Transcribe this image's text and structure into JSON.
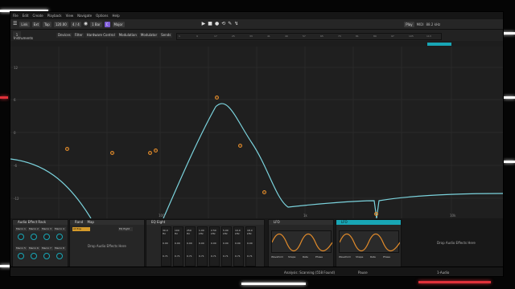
{
  "menu": [
    "File",
    "Edit",
    "Create",
    "Playback",
    "View",
    "Navigate",
    "Options",
    "Help"
  ],
  "transport": {
    "labels": [
      "Link",
      "Ext",
      "Tap",
      "120.00",
      "4 / 4",
      "1 Bar",
      "C",
      "Major"
    ],
    "right": [
      "Play",
      "MIDI",
      "88.2 kHz"
    ]
  },
  "track": {
    "label": "1"
  },
  "instrument_label": "Instruments",
  "device_tabs": [
    "Devices",
    "Filter",
    "Hardware Control",
    "Modulation",
    "Modulator",
    "Sends"
  ],
  "ruler_ticks": [
    "1",
    "9",
    "17",
    "25",
    "33",
    "41",
    "49",
    "57",
    "65",
    "73",
    "81",
    "89",
    "97",
    "105",
    "113"
  ],
  "db_labels": [
    "12",
    "6",
    "0",
    "-6",
    "-12"
  ],
  "freq_labels": [
    "100",
    "1k",
    "10k"
  ],
  "bottom": {
    "rack_title": "Audio Effect Rack",
    "rack_buttons": [
      "Rand",
      "Map"
    ],
    "macros": [
      "Macro 1",
      "Macro 2",
      "Macro 3",
      "Macro 4",
      "Macro 5",
      "Macro 6",
      "Macro 7",
      "Macro 8"
    ],
    "rack_list_title": "All Eqs",
    "chain_label": "EQ Eight",
    "drop_chain": "Drop Audio Effects Here",
    "eq_title": "EQ Eight",
    "eq_cols": [
      {
        "freq": "30.0 Hz",
        "gain": "0.00",
        "q": "0.71"
      },
      {
        "freq": "100 Hz",
        "gain": "0.00",
        "q": "0.71"
      },
      {
        "freq": "250 Hz",
        "gain": "0.00",
        "q": "0.71"
      },
      {
        "freq": "1.00 kHz",
        "gain": "0.00",
        "q": "0.71"
      },
      {
        "freq": "2.50 kHz",
        "gain": "0.00",
        "q": "0.71"
      },
      {
        "freq": "5.00 kHz",
        "gain": "0.00",
        "q": "0.71"
      },
      {
        "freq": "10.0 kHz",
        "gain": "0.00",
        "q": "0.71"
      },
      {
        "freq": "18.0 kHz",
        "gain": "0.00",
        "q": "0.71"
      }
    ],
    "lfo1_title": "LFO",
    "lfo2_title": "LFO",
    "lfo_params": [
      "Waveform",
      "Shape",
      "Rate",
      "Phase"
    ],
    "drop_main": "Drop Audio Effects Here"
  },
  "status": {
    "center": "Analysis: Scanning (558 Found)",
    "right": "Pause",
    "track": "1-Audio"
  },
  "colors": {
    "accent": "#18a6b5",
    "band": "#e08a2a",
    "highlight": "#7d5bd6"
  }
}
